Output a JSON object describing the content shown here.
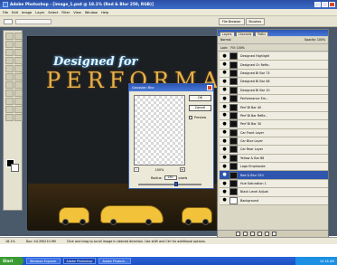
{
  "window": {
    "title": "Adobe Photoshop - [image_1.psd @ 18.1% (Red & Blur 250, RGB)]"
  },
  "menubar": {
    "items": [
      "File",
      "Edit",
      "Image",
      "Layer",
      "Select",
      "Filter",
      "View",
      "Window",
      "Help"
    ]
  },
  "palette_tabs": [
    "File Browser",
    "Brushes"
  ],
  "canvas": {
    "headline_script": "Designed for",
    "headline_main": "PERFORMANCE"
  },
  "dialog": {
    "title": "Gaussian Blur",
    "ok_label": "OK",
    "cancel_label": "Cancel",
    "preview_label": "Preview",
    "zoom_value": "100%",
    "zoom_out": "-",
    "zoom_in": "+",
    "radius_label": "Radius:",
    "radius_value": "250",
    "radius_unit": "pixels",
    "slider_position": 0.6
  },
  "layers_panel": {
    "tabs": [
      "Layers",
      "Channels",
      "Paths"
    ],
    "blend_mode": "Normal",
    "opacity_label": "Opacity: 100%",
    "lock_label": "Lock:",
    "fill_label": "Fill: 100%",
    "layers": [
      {
        "name": "Designed Highlight",
        "selected": false,
        "white_thumb": false
      },
      {
        "name": "Designed Ch Refle..",
        "selected": false,
        "white_thumb": false
      },
      {
        "name": "Designed Bl Bar 73",
        "selected": false,
        "white_thumb": false
      },
      {
        "name": "Designed Bl Bar 48",
        "selected": false,
        "white_thumb": false
      },
      {
        "name": "Designed Bl Bar 10",
        "selected": false,
        "white_thumb": false
      },
      {
        "name": "Performance Em...",
        "selected": false,
        "white_thumb": false
      },
      {
        "name": "Perf Bl Bar 40",
        "selected": false,
        "white_thumb": false
      },
      {
        "name": "Perf Bl Bar Refle..",
        "selected": false,
        "white_thumb": false
      },
      {
        "name": "Perf Bl Bar 30",
        "selected": false,
        "white_thumb": false
      },
      {
        "name": "Car Front Layer",
        "selected": false,
        "white_thumb": false
      },
      {
        "name": "Car Blue Layer",
        "selected": false,
        "white_thumb": false
      },
      {
        "name": "Car Rear Layer",
        "selected": false,
        "white_thumb": false
      },
      {
        "name": "Yellow & Bar 88",
        "selected": false,
        "white_thumb": false
      },
      {
        "name": "Logo Emphasize",
        "selected": false,
        "white_thumb": false
      },
      {
        "name": "Red & Blur 250",
        "selected": true,
        "white_thumb": false
      },
      {
        "name": "Hue Saturation 1",
        "selected": false,
        "white_thumb": false
      },
      {
        "name": "Black Level Adjust",
        "selected": false,
        "white_thumb": false
      },
      {
        "name": "Background",
        "selected": false,
        "white_thumb": true
      }
    ]
  },
  "statusbar": {
    "zoom": "18.1%",
    "doc_size": "Doc: 44.2M/210.9M",
    "hint": "Click and drag to scroll image in desired direction. Use shift and Ctrl for additional options."
  },
  "taskbar": {
    "start_label": "Start",
    "tasks": [
      "Windows Explorer",
      "Adobe Photoshop",
      "Adobe Photosh..."
    ],
    "clock": "10:18 AM"
  }
}
